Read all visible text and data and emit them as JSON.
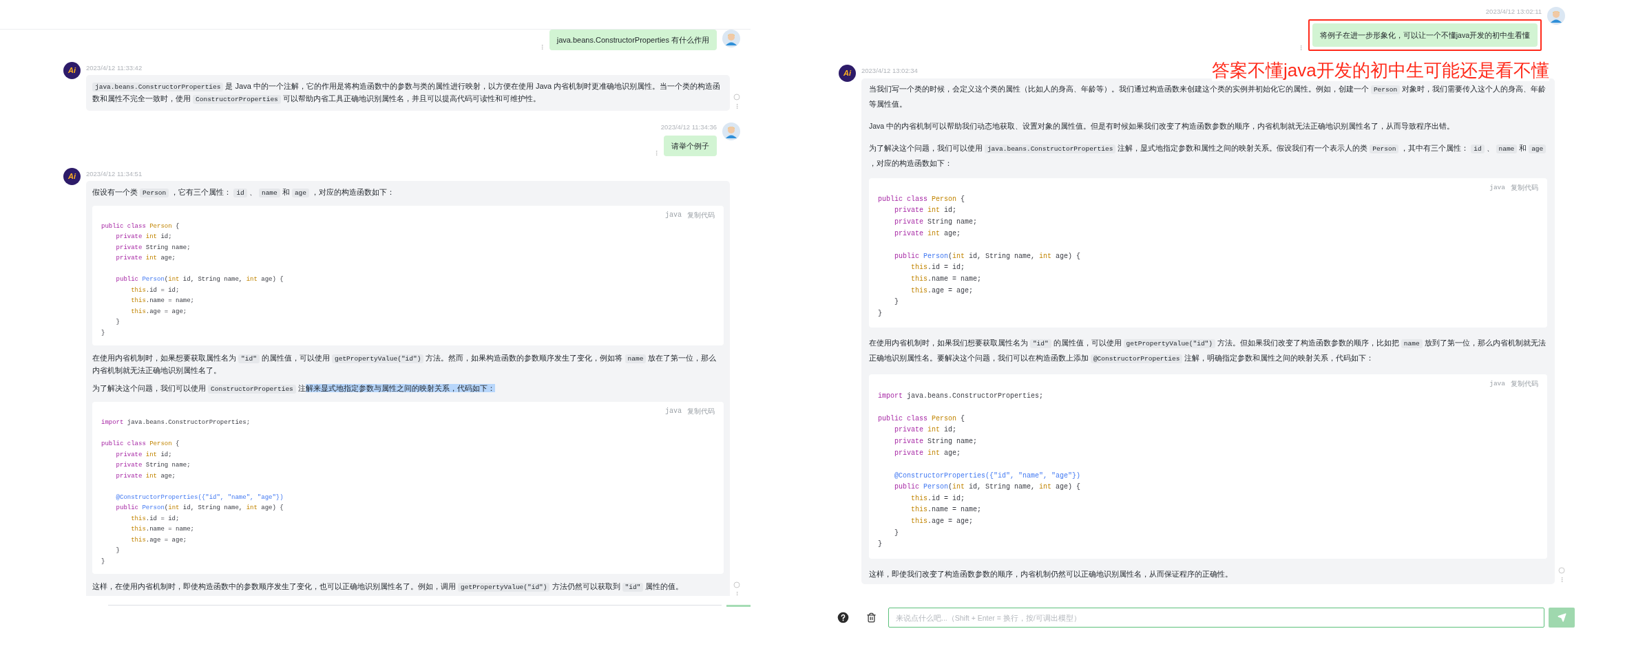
{
  "panels": [
    {
      "messages": [
        {
          "kind": "user",
          "boxed": false,
          "text": "java.beans.ConstructorProperties 有什么作用"
        },
        {
          "kind": "ai",
          "avatar_text": "Ai",
          "time": "2023/4/12 11:33:42",
          "blocks": [
            {
              "kind": "paragraph",
              "segments": [
                {
                  "text": "java.beans.ConstructorProperties",
                  "kind": "code"
                },
                {
                  "text": " 是 Java 中的一个注解，它的作用是将构造函数中的参数与类的属性进行映射，以方便在使用 Java 内省机制时更准确地识别属性。当一个类的构造函数和属性不完全一致时，使用 ",
                  "kind": "text"
                },
                {
                  "text": "ConstructorProperties",
                  "kind": "code"
                },
                {
                  "text": " 可以帮助内省工具正确地识别属性名，并且可以提高代码可读性和可维护性。",
                  "kind": "text"
                }
              ]
            }
          ]
        },
        {
          "kind": "user",
          "boxed": false,
          "time": "2023/4/12 11:34:36",
          "text": "请举个例子"
        },
        {
          "kind": "ai",
          "avatar_text": "Ai",
          "time": "2023/4/12 11:34:51",
          "blocks": [
            {
              "kind": "paragraph",
              "segments": [
                {
                  "text": "假设有一个类 ",
                  "kind": "text"
                },
                {
                  "text": "Person",
                  "kind": "code"
                },
                {
                  "text": " ，它有三个属性： ",
                  "kind": "text"
                },
                {
                  "text": "id",
                  "kind": "code"
                },
                {
                  "text": " 、 ",
                  "kind": "text"
                },
                {
                  "text": "name",
                  "kind": "code"
                },
                {
                  "text": " 和 ",
                  "kind": "text"
                },
                {
                  "text": "age",
                  "kind": "code"
                },
                {
                  "text": " ，对应的构造函数如下：",
                  "kind": "text"
                }
              ]
            },
            {
              "kind": "code",
              "language": "java",
              "copy_label": "复制代码",
              "lines": [
                {
                  "kind": "code",
                  "tokens": [
                    {
                      "text": "public class ",
                      "kind": "kw"
                    },
                    {
                      "text": "Person",
                      "kind": "type"
                    },
                    {
                      "text": " {",
                      "kind": "plain"
                    }
                  ]
                },
                {
                  "kind": "code",
                  "tokens": [
                    {
                      "text": "    private ",
                      "kind": "kw"
                    },
                    {
                      "text": "int",
                      "kind": "type"
                    },
                    {
                      "text": " id;",
                      "kind": "plain"
                    }
                  ]
                },
                {
                  "kind": "code",
                  "tokens": [
                    {
                      "text": "    private ",
                      "kind": "kw"
                    },
                    {
                      "text": "String name;",
                      "kind": "plain"
                    }
                  ]
                },
                {
                  "kind": "code",
                  "tokens": [
                    {
                      "text": "    private ",
                      "kind": "kw"
                    },
                    {
                      "text": "int",
                      "kind": "type"
                    },
                    {
                      "text": " age;",
                      "kind": "plain"
                    }
                  ]
                },
                {
                  "kind": "blank"
                },
                {
                  "kind": "code",
                  "tokens": [
                    {
                      "text": "    public ",
                      "kind": "kw"
                    },
                    {
                      "text": "Person",
                      "kind": "fn"
                    },
                    {
                      "text": "(",
                      "kind": "plain"
                    },
                    {
                      "text": "int",
                      "kind": "type"
                    },
                    {
                      "text": " id, String name, ",
                      "kind": "plain"
                    },
                    {
                      "text": "int",
                      "kind": "type"
                    },
                    {
                      "text": " age) {",
                      "kind": "plain"
                    }
                  ]
                },
                {
                  "kind": "code",
                  "tokens": [
                    {
                      "text": "        this",
                      "kind": "type"
                    },
                    {
                      "text": ".id = id;",
                      "kind": "plain"
                    }
                  ]
                },
                {
                  "kind": "code",
                  "tokens": [
                    {
                      "text": "        this",
                      "kind": "type"
                    },
                    {
                      "text": ".name = name;",
                      "kind": "plain"
                    }
                  ]
                },
                {
                  "kind": "code",
                  "tokens": [
                    {
                      "text": "        this",
                      "kind": "type"
                    },
                    {
                      "text": ".age = age;",
                      "kind": "plain"
                    }
                  ]
                },
                {
                  "kind": "code",
                  "tokens": [
                    {
                      "text": "    }",
                      "kind": "plain"
                    }
                  ]
                },
                {
                  "kind": "code",
                  "tokens": [
                    {
                      "text": "}",
                      "kind": "plain"
                    }
                  ]
                }
              ]
            },
            {
              "kind": "paragraph",
              "segments": [
                {
                  "text": "在使用内省机制时，如果想要获取属性名为 ",
                  "kind": "text"
                },
                {
                  "text": "\"id\"",
                  "kind": "code"
                },
                {
                  "text": " 的属性值，可以使用 ",
                  "kind": "text"
                },
                {
                  "text": "getPropertyValue(\"id\")",
                  "kind": "code"
                },
                {
                  "text": " 方法。然而，如果构造函数的参数顺序发生了变化，例如将 ",
                  "kind": "text"
                },
                {
                  "text": "name",
                  "kind": "code"
                },
                {
                  "text": " 放在了第一位，那么内省机制就无法正确地识别属性名了。",
                  "kind": "text"
                }
              ]
            },
            {
              "kind": "paragraph",
              "segments": [
                {
                  "text": "为了解决这个问题，我们可以使用 ",
                  "kind": "text"
                },
                {
                  "text": "ConstructorProperties",
                  "kind": "code"
                },
                {
                  "text": " 注",
                  "kind": "text"
                },
                {
                  "text": "解来显式地指定参数与属性之间的映射关系，代码如下：",
                  "kind": "mark"
                }
              ]
            },
            {
              "kind": "code",
              "language": "java",
              "copy_label": "复制代码",
              "lines": [
                {
                  "kind": "code",
                  "tokens": [
                    {
                      "text": "import",
                      "kind": "kw"
                    },
                    {
                      "text": " java.beans.ConstructorProperties;",
                      "kind": "plain"
                    }
                  ]
                },
                {
                  "kind": "blank"
                },
                {
                  "kind": "code",
                  "tokens": [
                    {
                      "text": "public class ",
                      "kind": "kw"
                    },
                    {
                      "text": "Person",
                      "kind": "type"
                    },
                    {
                      "text": " {",
                      "kind": "plain"
                    }
                  ]
                },
                {
                  "kind": "code",
                  "tokens": [
                    {
                      "text": "    private ",
                      "kind": "kw"
                    },
                    {
                      "text": "int",
                      "kind": "type"
                    },
                    {
                      "text": " id;",
                      "kind": "plain"
                    }
                  ]
                },
                {
                  "kind": "code",
                  "tokens": [
                    {
                      "text": "    private ",
                      "kind": "kw"
                    },
                    {
                      "text": "String name;",
                      "kind": "plain"
                    }
                  ]
                },
                {
                  "kind": "code",
                  "tokens": [
                    {
                      "text": "    private ",
                      "kind": "kw"
                    },
                    {
                      "text": "int",
                      "kind": "type"
                    },
                    {
                      "text": " age;",
                      "kind": "plain"
                    }
                  ]
                },
                {
                  "kind": "blank"
                },
                {
                  "kind": "code",
                  "tokens": [
                    {
                      "text": "    @ConstructorProperties({\"id\", \"name\", \"age\"})",
                      "kind": "fn"
                    }
                  ]
                },
                {
                  "kind": "code",
                  "tokens": [
                    {
                      "text": "    public ",
                      "kind": "kw"
                    },
                    {
                      "text": "Person",
                      "kind": "fn"
                    },
                    {
                      "text": "(",
                      "kind": "plain"
                    },
                    {
                      "text": "int",
                      "kind": "type"
                    },
                    {
                      "text": " id, String name, ",
                      "kind": "plain"
                    },
                    {
                      "text": "int",
                      "kind": "type"
                    },
                    {
                      "text": " age) {",
                      "kind": "plain"
                    }
                  ]
                },
                {
                  "kind": "code",
                  "tokens": [
                    {
                      "text": "        this",
                      "kind": "type"
                    },
                    {
                      "text": ".id = id;",
                      "kind": "plain"
                    }
                  ]
                },
                {
                  "kind": "code",
                  "tokens": [
                    {
                      "text": "        this",
                      "kind": "type"
                    },
                    {
                      "text": ".name = name;",
                      "kind": "plain"
                    }
                  ]
                },
                {
                  "kind": "code",
                  "tokens": [
                    {
                      "text": "        this",
                      "kind": "type"
                    },
                    {
                      "text": ".age = age;",
                      "kind": "plain"
                    }
                  ]
                },
                {
                  "kind": "code",
                  "tokens": [
                    {
                      "text": "    }",
                      "kind": "plain"
                    }
                  ]
                },
                {
                  "kind": "code",
                  "tokens": [
                    {
                      "text": "}",
                      "kind": "plain"
                    }
                  ]
                }
              ]
            },
            {
              "kind": "paragraph",
              "segments": [
                {
                  "text": "这样，在使用内省机制时，即使构造函数中的参数顺序发生了变化，也可以正确地识别属性名了。例如，调用 ",
                  "kind": "text"
                },
                {
                  "text": "getPropertyValue(\"id\")",
                  "kind": "code"
                },
                {
                  "text": " 方法仍然可以获取到 ",
                  "kind": "text"
                },
                {
                  "text": "\"id\"",
                  "kind": "code"
                },
                {
                  "text": " 属性的值。",
                  "kind": "text"
                }
              ]
            }
          ]
        }
      ],
      "composer_cut": true
    },
    {
      "messages": [
        {
          "kind": "user",
          "boxed": true,
          "time": "2023/4/12 13:02:11",
          "text": "将例子在进一步形象化，可以让一个不懂java开发的初中生看懂"
        },
        {
          "kind": "ai",
          "avatar_text": "Ai",
          "time": "2023/4/12 13:02:34",
          "blocks": [
            {
              "kind": "paragraph",
              "segments": [
                {
                  "text": "当我们写一个类的时候，会定义这个类的属性（比如人的身高、年龄等）。我们通过构造函数来创建这个类的实例并初始化它的属性。例如，创建一个 ",
                  "kind": "text"
                },
                {
                  "text": "Person",
                  "kind": "code"
                },
                {
                  "text": " 对象时，我们需要传入这个人的身高、年龄等属性值。",
                  "kind": "text"
                }
              ]
            },
            {
              "kind": "paragraph",
              "segments": [
                {
                  "text": "Java 中的内省机制可以帮助我们动态地获取、设置对象的属性值。但是有时候如果我们改变了构造函数参数的顺序，内省机制就无法正确地识别属性名了，从而导致程序出错。",
                  "kind": "text"
                }
              ]
            },
            {
              "kind": "paragraph",
              "segments": [
                {
                  "text": "为了解决这个问题，我们可以使用 ",
                  "kind": "text"
                },
                {
                  "text": "java.beans.ConstructorProperties",
                  "kind": "code"
                },
                {
                  "text": " 注解，显式地指定参数和属性之间的映射关系。假设我们有一个表示人的类 ",
                  "kind": "text"
                },
                {
                  "text": "Person",
                  "kind": "code"
                },
                {
                  "text": " ，其中有三个属性： ",
                  "kind": "text"
                },
                {
                  "text": "id",
                  "kind": "code"
                },
                {
                  "text": " 、 ",
                  "kind": "text"
                },
                {
                  "text": "name",
                  "kind": "code"
                },
                {
                  "text": " 和 ",
                  "kind": "text"
                },
                {
                  "text": "age",
                  "kind": "code"
                },
                {
                  "text": " ，对应的构造函数如下：",
                  "kind": "text"
                }
              ]
            },
            {
              "kind": "code",
              "language": "java",
              "copy_label": "复制代码",
              "lines": [
                {
                  "kind": "code",
                  "tokens": [
                    {
                      "text": "public class ",
                      "kind": "kw"
                    },
                    {
                      "text": "Person",
                      "kind": "type"
                    },
                    {
                      "text": " {",
                      "kind": "plain"
                    }
                  ]
                },
                {
                  "kind": "code",
                  "tokens": [
                    {
                      "text": "    private ",
                      "kind": "kw"
                    },
                    {
                      "text": "int",
                      "kind": "type"
                    },
                    {
                      "text": " id;",
                      "kind": "plain"
                    }
                  ]
                },
                {
                  "kind": "code",
                  "tokens": [
                    {
                      "text": "    private ",
                      "kind": "kw"
                    },
                    {
                      "text": "String name;",
                      "kind": "plain"
                    }
                  ]
                },
                {
                  "kind": "code",
                  "tokens": [
                    {
                      "text": "    private ",
                      "kind": "kw"
                    },
                    {
                      "text": "int",
                      "kind": "type"
                    },
                    {
                      "text": " age;",
                      "kind": "plain"
                    }
                  ]
                },
                {
                  "kind": "blank"
                },
                {
                  "kind": "code",
                  "tokens": [
                    {
                      "text": "    public ",
                      "kind": "kw"
                    },
                    {
                      "text": "Person",
                      "kind": "fn"
                    },
                    {
                      "text": "(",
                      "kind": "plain"
                    },
                    {
                      "text": "int",
                      "kind": "type"
                    },
                    {
                      "text": " id, String name, ",
                      "kind": "plain"
                    },
                    {
                      "text": "int",
                      "kind": "type"
                    },
                    {
                      "text": " age) {",
                      "kind": "plain"
                    }
                  ]
                },
                {
                  "kind": "code",
                  "tokens": [
                    {
                      "text": "        this",
                      "kind": "type"
                    },
                    {
                      "text": ".id = id;",
                      "kind": "plain"
                    }
                  ]
                },
                {
                  "kind": "code",
                  "tokens": [
                    {
                      "text": "        this",
                      "kind": "type"
                    },
                    {
                      "text": ".name = name;",
                      "kind": "plain"
                    }
                  ]
                },
                {
                  "kind": "code",
                  "tokens": [
                    {
                      "text": "        this",
                      "kind": "type"
                    },
                    {
                      "text": ".age = age;",
                      "kind": "plain"
                    }
                  ]
                },
                {
                  "kind": "code",
                  "tokens": [
                    {
                      "text": "    }",
                      "kind": "plain"
                    }
                  ]
                },
                {
                  "kind": "code",
                  "tokens": [
                    {
                      "text": "}",
                      "kind": "plain"
                    }
                  ]
                }
              ]
            },
            {
              "kind": "paragraph",
              "segments": [
                {
                  "text": "在使用内省机制时，如果我们想要获取属性名为 ",
                  "kind": "text"
                },
                {
                  "text": "\"id\"",
                  "kind": "code"
                },
                {
                  "text": " 的属性值，可以使用 ",
                  "kind": "text"
                },
                {
                  "text": "getPropertyValue(\"id\")",
                  "kind": "code"
                },
                {
                  "text": " 方法。但如果我们改变了构造函数参数的顺序，比如把 ",
                  "kind": "text"
                },
                {
                  "text": "name",
                  "kind": "code"
                },
                {
                  "text": " 放到了第一位，那么内省机制就无法正确地识别属性名。要解决这个问题，我们可以在构造函数上添加 ",
                  "kind": "text"
                },
                {
                  "text": "@ConstructorProperties",
                  "kind": "code"
                },
                {
                  "text": " 注解，明确指定参数和属性之间的映射关系，代码如下：",
                  "kind": "text"
                }
              ]
            },
            {
              "kind": "code",
              "language": "java",
              "copy_label": "复制代码",
              "lines": [
                {
                  "kind": "code",
                  "tokens": [
                    {
                      "text": "import",
                      "kind": "kw"
                    },
                    {
                      "text": " java.beans.ConstructorProperties;",
                      "kind": "plain"
                    }
                  ]
                },
                {
                  "kind": "blank"
                },
                {
                  "kind": "code",
                  "tokens": [
                    {
                      "text": "public class ",
                      "kind": "kw"
                    },
                    {
                      "text": "Person",
                      "kind": "type"
                    },
                    {
                      "text": " {",
                      "kind": "plain"
                    }
                  ]
                },
                {
                  "kind": "code",
                  "tokens": [
                    {
                      "text": "    private ",
                      "kind": "kw"
                    },
                    {
                      "text": "int",
                      "kind": "type"
                    },
                    {
                      "text": " id;",
                      "kind": "plain"
                    }
                  ]
                },
                {
                  "kind": "code",
                  "tokens": [
                    {
                      "text": "    private ",
                      "kind": "kw"
                    },
                    {
                      "text": "String name;",
                      "kind": "plain"
                    }
                  ]
                },
                {
                  "kind": "code",
                  "tokens": [
                    {
                      "text": "    private ",
                      "kind": "kw"
                    },
                    {
                      "text": "int",
                      "kind": "type"
                    },
                    {
                      "text": " age;",
                      "kind": "plain"
                    }
                  ]
                },
                {
                  "kind": "blank"
                },
                {
                  "kind": "code",
                  "tokens": [
                    {
                      "text": "    @ConstructorProperties({\"id\", \"name\", \"age\"})",
                      "kind": "fn"
                    }
                  ]
                },
                {
                  "kind": "code",
                  "tokens": [
                    {
                      "text": "    public ",
                      "kind": "kw"
                    },
                    {
                      "text": "Person",
                      "kind": "fn"
                    },
                    {
                      "text": "(",
                      "kind": "plain"
                    },
                    {
                      "text": "int",
                      "kind": "type"
                    },
                    {
                      "text": " id, String name, ",
                      "kind": "plain"
                    },
                    {
                      "text": "int",
                      "kind": "type"
                    },
                    {
                      "text": " age) {",
                      "kind": "plain"
                    }
                  ]
                },
                {
                  "kind": "code",
                  "tokens": [
                    {
                      "text": "        this",
                      "kind": "type"
                    },
                    {
                      "text": ".id = id;",
                      "kind": "plain"
                    }
                  ]
                },
                {
                  "kind": "code",
                  "tokens": [
                    {
                      "text": "        this",
                      "kind": "type"
                    },
                    {
                      "text": ".name = name;",
                      "kind": "plain"
                    }
                  ]
                },
                {
                  "kind": "code",
                  "tokens": [
                    {
                      "text": "        this",
                      "kind": "type"
                    },
                    {
                      "text": ".age = age;",
                      "kind": "plain"
                    }
                  ]
                },
                {
                  "kind": "code",
                  "tokens": [
                    {
                      "text": "    }",
                      "kind": "plain"
                    }
                  ]
                },
                {
                  "kind": "code",
                  "tokens": [
                    {
                      "text": "}",
                      "kind": "plain"
                    }
                  ]
                }
              ]
            },
            {
              "kind": "paragraph",
              "segments": [
                {
                  "text": "这样，即使我们改变了构造函数参数的顺序，内省机制仍然可以正确地识别属性名，从而保证程序的正确性。",
                  "kind": "text"
                }
              ]
            }
          ]
        }
      ],
      "annotation": "答案不懂java开发的初中生可能还是看不懂",
      "composer": {
        "placeholder": "来说点什么吧...（Shift + Enter = 换行，按/可调出模型）"
      }
    }
  ]
}
